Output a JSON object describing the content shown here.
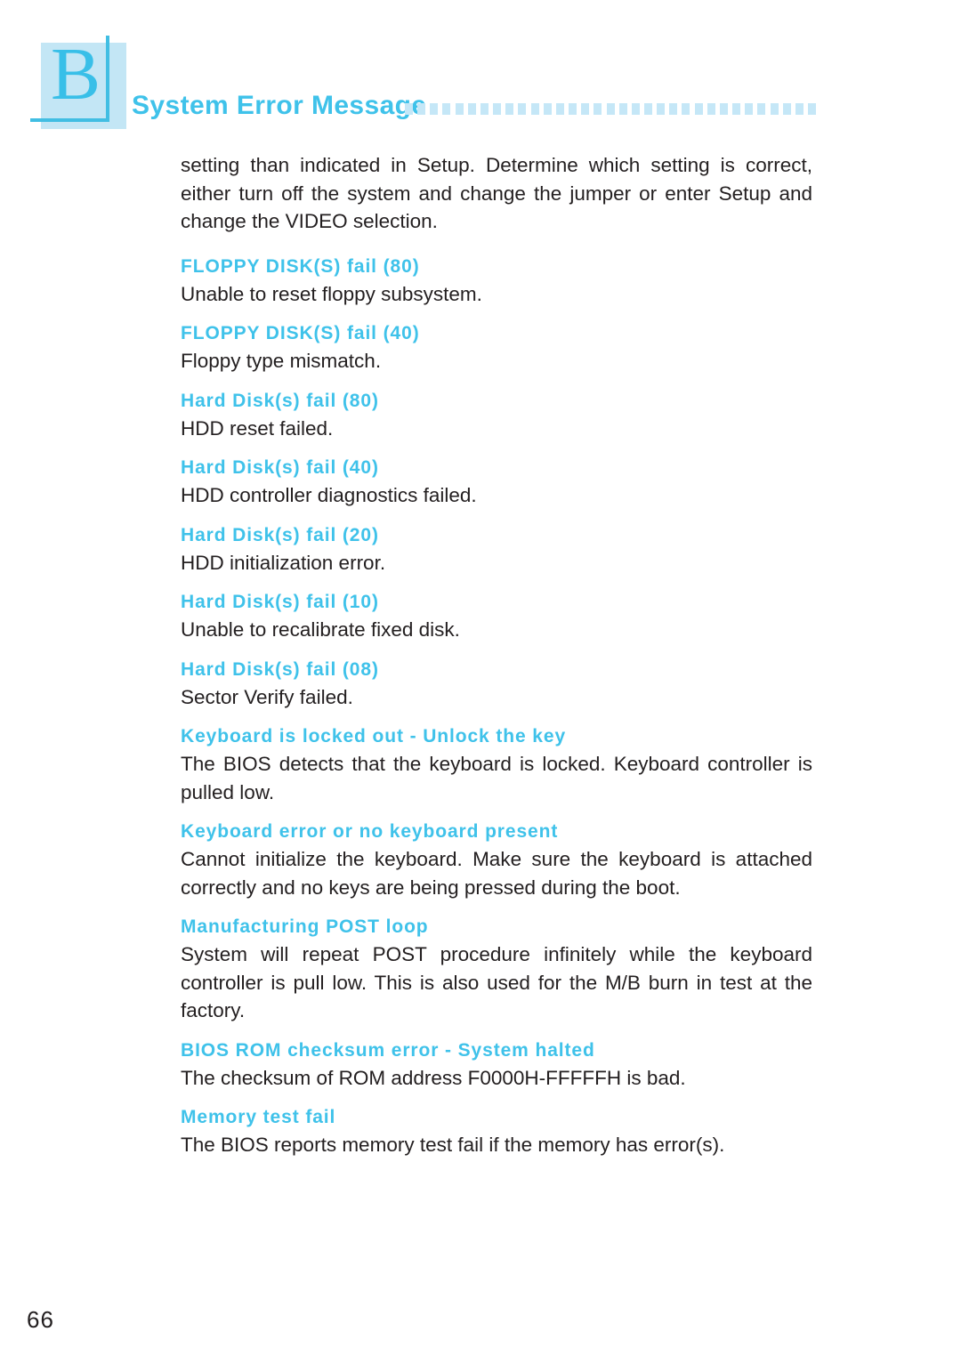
{
  "header": {
    "appendix_letter": "B",
    "title": "System Error Message",
    "decoration": "dotted-square-rule",
    "dot_count": 33
  },
  "colors": {
    "accent": "#3fc2ea",
    "accent_light": "#c5e7f7",
    "accent_rule": "#41bee3",
    "text": "#231f20",
    "background": "#ffffff"
  },
  "content": {
    "intro": "setting than indicated in Setup. Determine which setting is correct, either turn off the system and change the jumper or enter Setup and change the VIDEO selection.",
    "entries": [
      {
        "title": "FLOPPY DISK(S) fail (80)",
        "description": "Unable to reset floppy subsystem."
      },
      {
        "title": "FLOPPY DISK(S) fail (40)",
        "description": "Floppy type mismatch."
      },
      {
        "title": "Hard Disk(s) fail (80)",
        "description": "HDD reset failed."
      },
      {
        "title": "Hard Disk(s) fail (40)",
        "description": "HDD controller diagnostics failed."
      },
      {
        "title": "Hard Disk(s) fail (20)",
        "description": "HDD initialization error."
      },
      {
        "title": "Hard Disk(s) fail (10)",
        "description": "Unable to recalibrate fixed disk."
      },
      {
        "title": "Hard Disk(s) fail (08)",
        "description": "Sector Verify failed."
      },
      {
        "title": "Keyboard is locked out - Unlock the key",
        "description": "The BIOS detects that the keyboard is locked. Keyboard controller is pulled low."
      },
      {
        "title": "Keyboard error or no keyboard present",
        "description": "Cannot initialize the keyboard. Make sure the keyboard is attached correctly and no keys are being pressed during the boot."
      },
      {
        "title": "Manufacturing POST loop",
        "description": "System will repeat POST procedure infinitely while the keyboard controller is pull low. This is also used for the M/B burn in test at the factory."
      },
      {
        "title": "BIOS ROM checksum error - System halted",
        "description": "The checksum of ROM address F0000H-FFFFFH is bad."
      },
      {
        "title": "Memory test fail",
        "description": "The BIOS reports memory test fail if the memory has error(s)."
      }
    ]
  },
  "footer": {
    "page_number": "66"
  }
}
